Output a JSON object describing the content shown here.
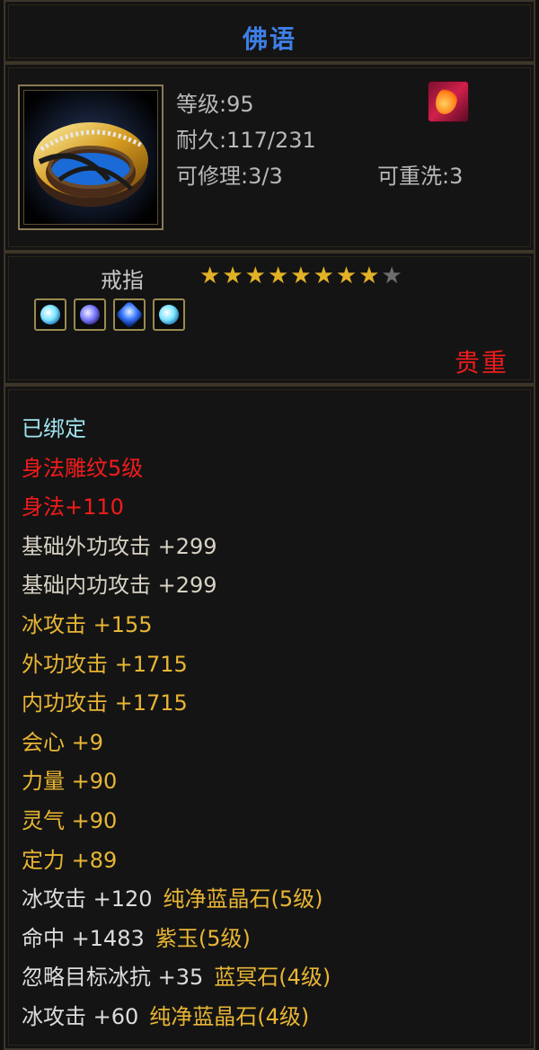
{
  "title": "佛语",
  "info": {
    "level": "等级:95",
    "durability": "耐久:117/231",
    "repair": "可修理:3/3",
    "rewash": "可重洗:3"
  },
  "item": {
    "type": "戒指",
    "stars_filled": 8,
    "stars_total": 9,
    "gems": [
      "cyan-gem-icon",
      "purple-gem-icon",
      "blue-gem-icon",
      "cyan-gem-icon"
    ],
    "rarity": "贵重"
  },
  "attributes": [
    {
      "text": "已绑定",
      "color": "cyan"
    },
    {
      "text": "身法雕纹5级",
      "color": "red"
    },
    {
      "text": "身法+110",
      "color": "red"
    },
    {
      "text": "基础外功攻击 +299",
      "color": "light"
    },
    {
      "text": "基础内功攻击 +299",
      "color": "light"
    },
    {
      "text": "冰攻击 +155",
      "color": "gold"
    },
    {
      "text": "外功攻击 +1715",
      "color": "gold"
    },
    {
      "text": "内功攻击 +1715",
      "color": "gold"
    },
    {
      "text": "会心 +9",
      "color": "gold"
    },
    {
      "text": "力量 +90",
      "color": "gold"
    },
    {
      "text": "灵气 +90",
      "color": "gold"
    },
    {
      "text": "定力 +89",
      "color": "gold"
    }
  ],
  "gem_attributes": [
    {
      "stat": "冰攻击 +120",
      "gem": "纯净蓝晶石(5级)"
    },
    {
      "stat": "命中 +1483",
      "gem": "紫玉(5级)"
    },
    {
      "stat": "忽略目标冰抗 +35",
      "gem": "蓝冥石(4级)"
    },
    {
      "stat": "冰攻击 +60",
      "gem": "纯净蓝晶石(4级)"
    }
  ]
}
